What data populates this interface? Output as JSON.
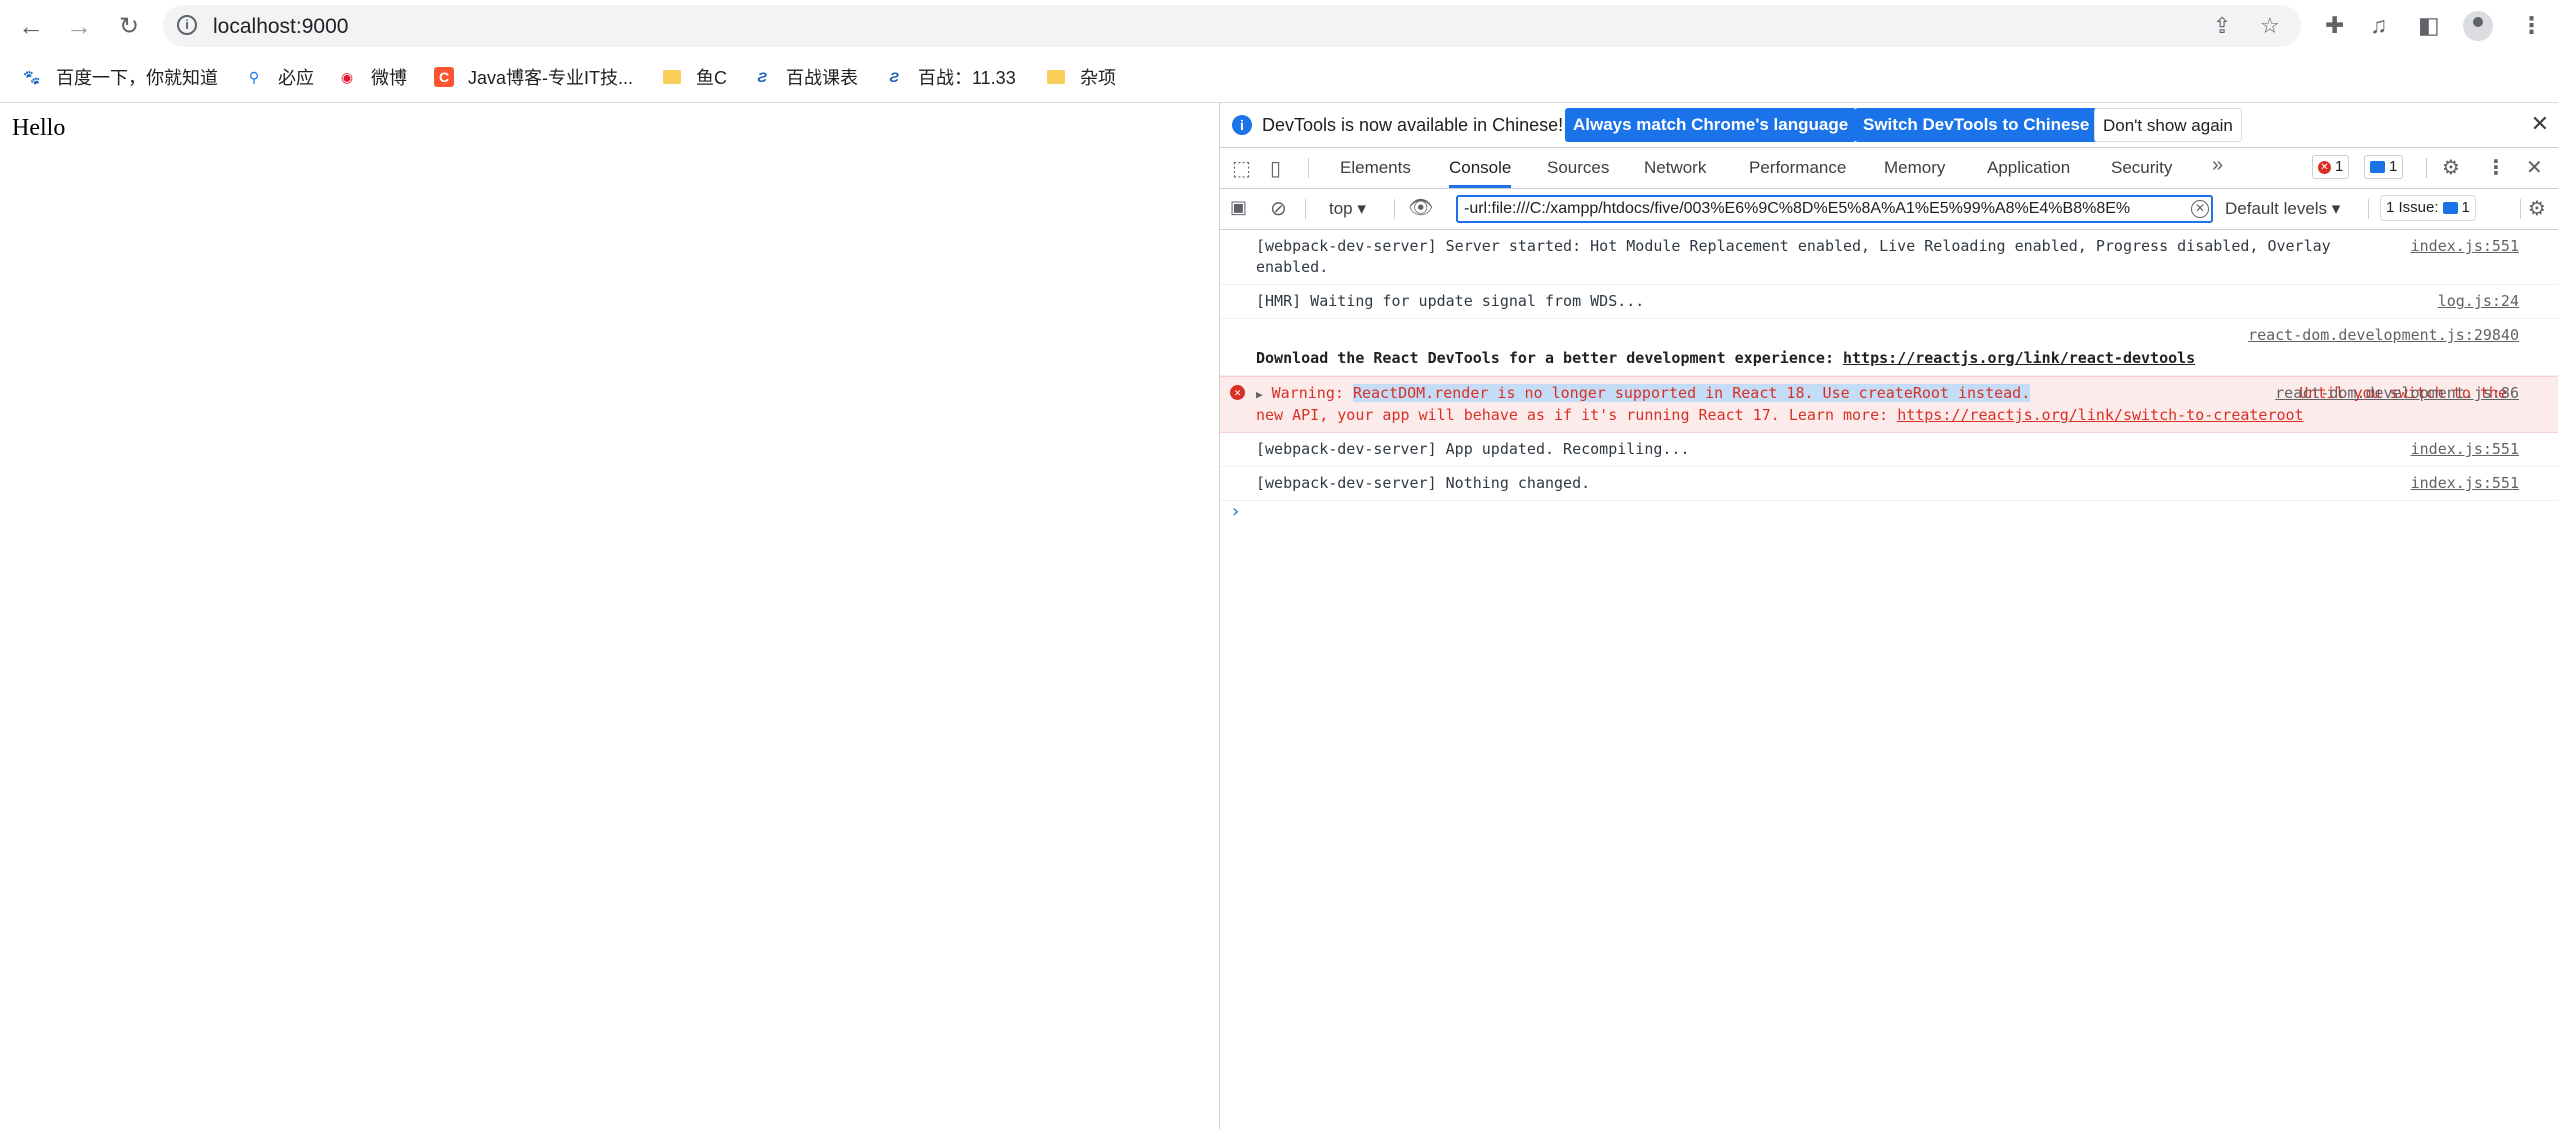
{
  "browser": {
    "url": "localhost:9000",
    "bookmarks": [
      {
        "label": "百度一下，你就知道",
        "icon": "baidu-icon"
      },
      {
        "label": "必应",
        "icon": "bing-search-icon"
      },
      {
        "label": "微博",
        "icon": "weibo-icon"
      },
      {
        "label": "Java博客-专业IT技...",
        "icon": "csdn-icon"
      },
      {
        "label": "鱼C",
        "icon": "folder-icon"
      },
      {
        "label": "百战课表",
        "icon": "baizhan-icon"
      },
      {
        "label": "百战：11.33",
        "icon": "baizhan-icon"
      },
      {
        "label": "杂项",
        "icon": "folder-icon"
      }
    ]
  },
  "page": {
    "text": "Hello"
  },
  "devtools": {
    "infobar": {
      "message": "DevTools is now available in Chinese!",
      "btn_match": "Always match Chrome's language",
      "btn_switch": "Switch DevTools to Chinese",
      "btn_dismiss": "Don't show again"
    },
    "tabs": [
      "Elements",
      "Console",
      "Sources",
      "Network",
      "Performance",
      "Memory",
      "Application",
      "Security"
    ],
    "active_tab": "Console",
    "error_count": "1",
    "message_count": "1",
    "context": "top",
    "filter": "-url:file:///C:/xampp/htdocs/five/003%E6%9C%8D%E5%8A%A1%E5%99%A8%E4%B8%8E%",
    "levels": "Default levels",
    "issues": "1 Issue:",
    "issues_count": "1",
    "messages": {
      "m1_text": "[webpack-dev-server] Server started: Hot Module Replacement enabled, Live Reloading enabled, Progress disabled, Overlay enabled.",
      "m1_src": "index.js:551",
      "m2_text": "[HMR] Waiting for update signal from WDS...",
      "m2_src": "log.js:24",
      "m3_src": "react-dom.development.js:29840",
      "m3_text": "Download the React DevTools for a better development experience: ",
      "m3_link": "https://reactjs.org/link/react-devtools",
      "m4_prefix": "Warning: ",
      "m4_highlight": "ReactDOM.render is no longer supported in React 18. Use createRoot instead.",
      "m4_rest": " Until you switch to the new API, your app will behave as if it's running React 17. Learn more: ",
      "m4_link": "https://reactjs.org/link/switch-to-createroot",
      "m4_src": "react-dom.development.js:86",
      "m5_text": "[webpack-dev-server] App updated. Recompiling...",
      "m5_src": "index.js:551",
      "m6_text": "[webpack-dev-server] Nothing changed.",
      "m6_src": "index.js:551"
    }
  }
}
